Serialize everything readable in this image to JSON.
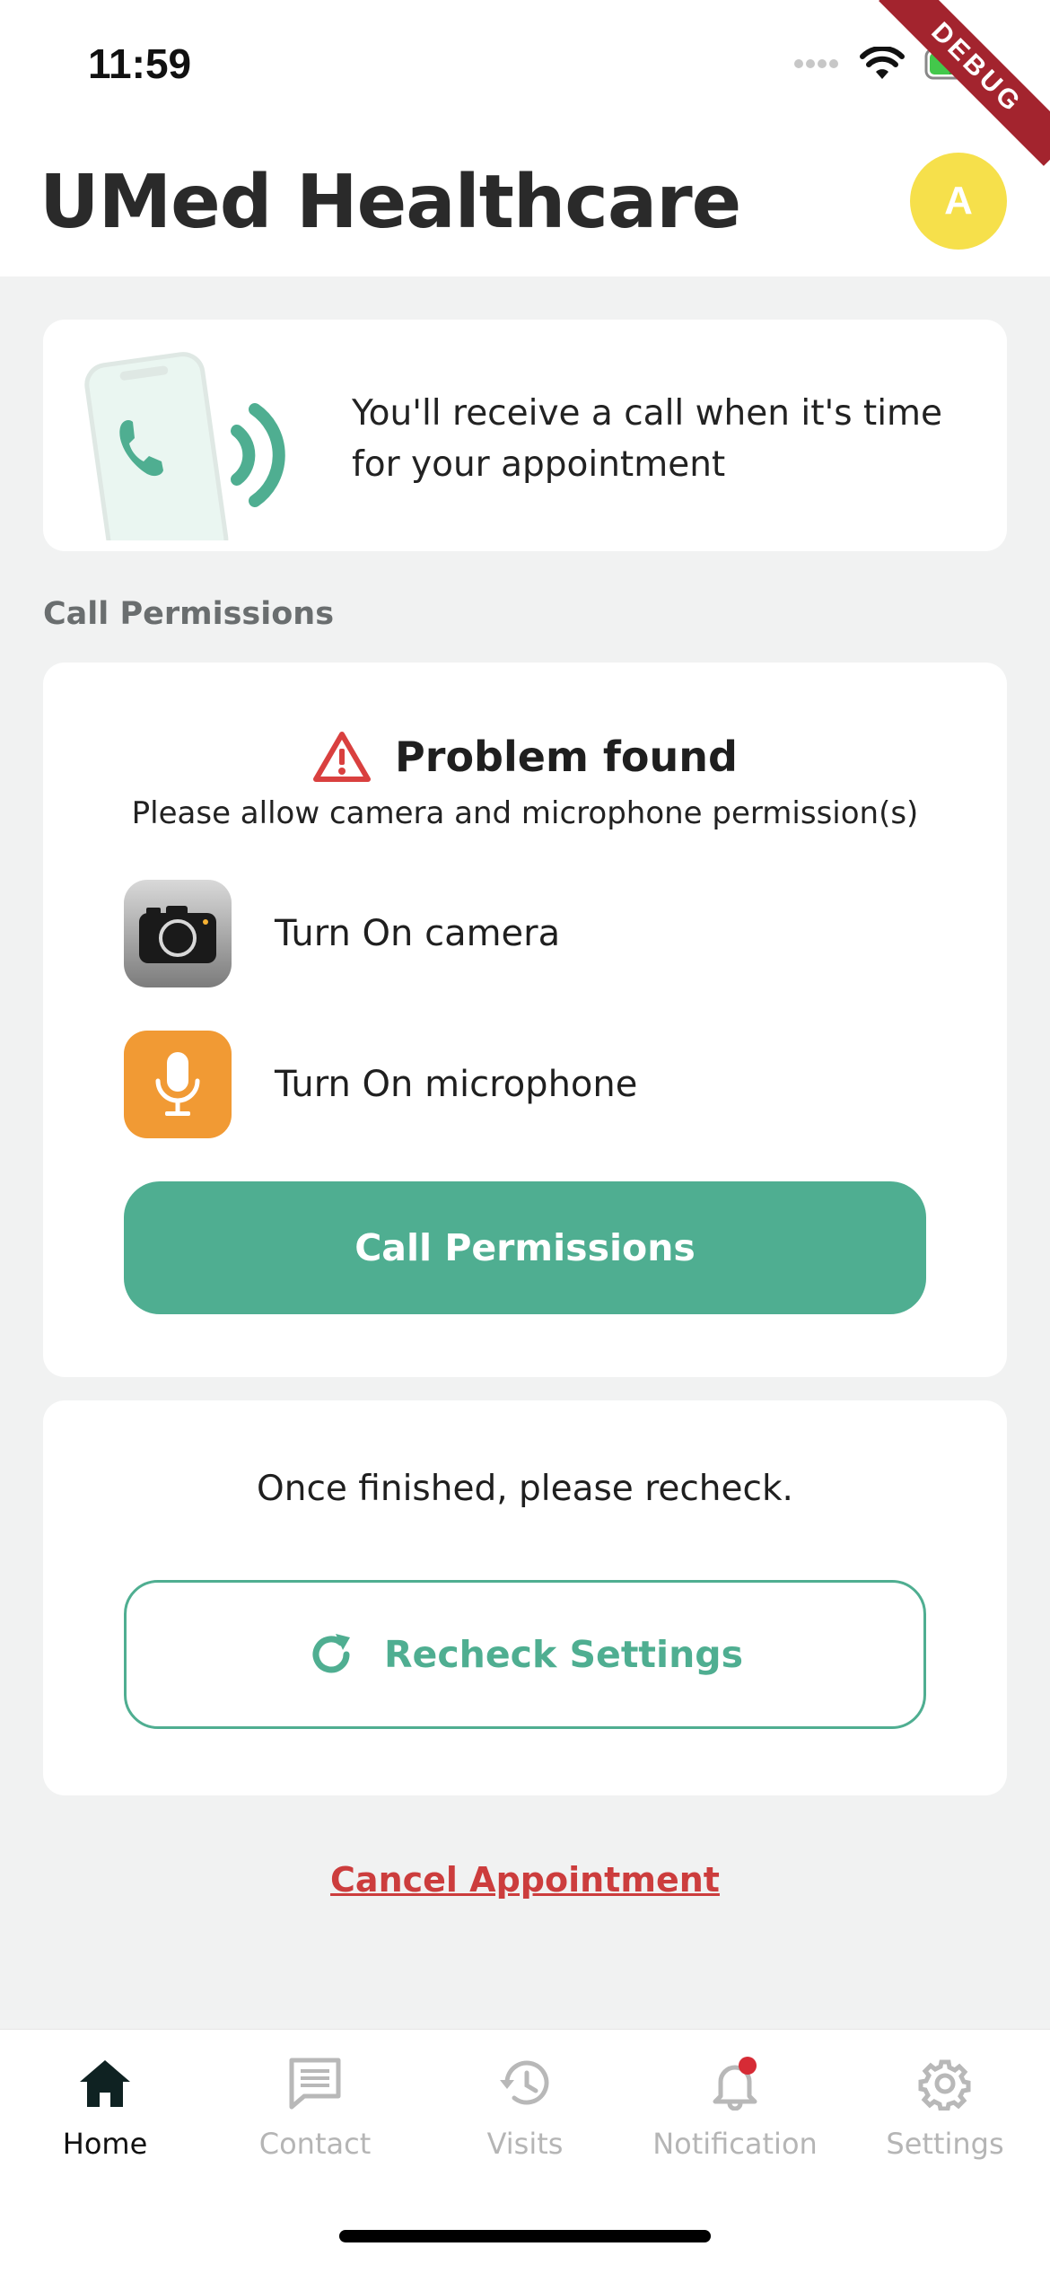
{
  "status_bar": {
    "time": "11:59",
    "debug_label": "DEBUG"
  },
  "header": {
    "title": "UMed Healthcare",
    "avatar_initial": "A"
  },
  "info_card": {
    "message": "You'll receive a call when it's time for your appointment"
  },
  "permissions": {
    "section_label": "Call Permissions",
    "problem_title": "Problem found",
    "problem_subtitle": "Please allow camera and microphone permission(s)",
    "items": [
      {
        "label": "Turn On camera",
        "icon": "camera-icon"
      },
      {
        "label": "Turn On microphone",
        "icon": "microphone-icon"
      }
    ],
    "button_label": "Call Permissions"
  },
  "recheck": {
    "message": "Once finished, please recheck.",
    "button_label": "Recheck Settings"
  },
  "cancel_label": "Cancel Appointment",
  "nav": {
    "items": [
      {
        "label": "Home",
        "icon": "home-icon",
        "active": true
      },
      {
        "label": "Contact",
        "icon": "chat-icon",
        "active": false
      },
      {
        "label": "Visits",
        "icon": "history-icon",
        "active": false
      },
      {
        "label": "Notification",
        "icon": "bell-icon",
        "active": false
      },
      {
        "label": "Settings",
        "icon": "gear-icon",
        "active": false
      }
    ]
  },
  "colors": {
    "accent": "#4fae91",
    "danger": "#cc3d3d",
    "avatar": "#f6e04b",
    "background": "#f1f2f2"
  }
}
